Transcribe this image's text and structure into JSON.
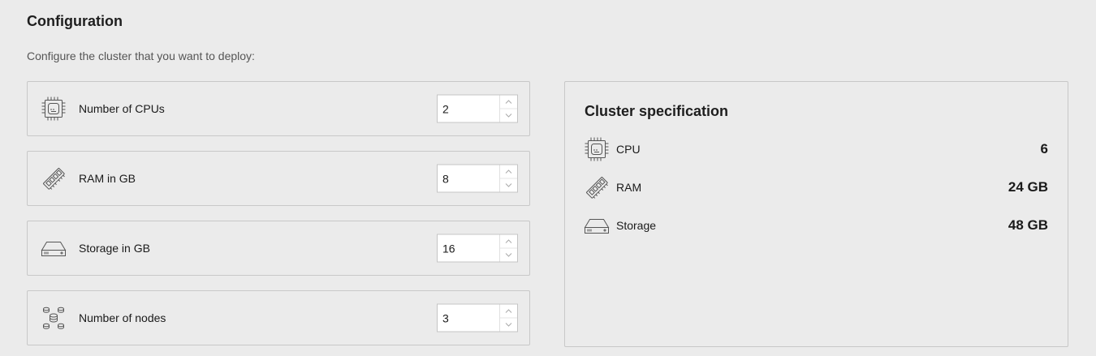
{
  "header": {
    "title": "Configuration",
    "subtitle": "Configure the cluster that you want to deploy:"
  },
  "config": {
    "items": [
      {
        "icon": "cpu-icon",
        "label": "Number of CPUs",
        "value": "2"
      },
      {
        "icon": "ram-icon",
        "label": "RAM in GB",
        "value": "8"
      },
      {
        "icon": "storage-icon",
        "label": "Storage in GB",
        "value": "16"
      },
      {
        "icon": "nodes-icon",
        "label": "Number of nodes",
        "value": "3"
      }
    ]
  },
  "spec": {
    "title": "Cluster specification",
    "rows": [
      {
        "icon": "cpu-icon",
        "name": "CPU",
        "value": "6"
      },
      {
        "icon": "ram-icon",
        "name": "RAM",
        "value": "24 GB"
      },
      {
        "icon": "storage-icon",
        "name": "Storage",
        "value": "48 GB"
      }
    ]
  }
}
